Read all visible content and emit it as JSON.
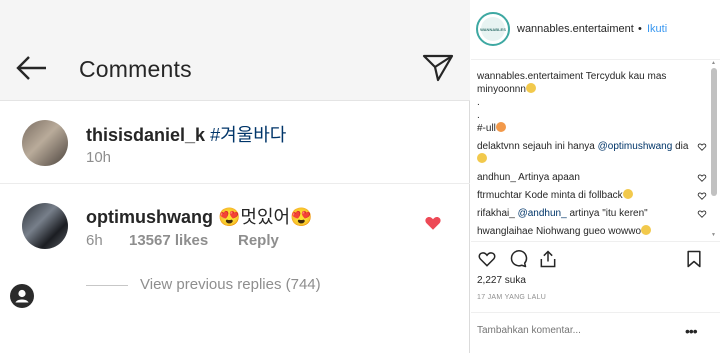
{
  "app": {
    "header_title": "Comments",
    "comments": [
      {
        "username": "thisisdaniel_k",
        "text": "#겨울바다",
        "time": "10h"
      },
      {
        "username": "optimushwang",
        "text": "😍멋있어😍",
        "time": "6h",
        "likes": "13567 likes",
        "reply": "Reply"
      }
    ],
    "view_previous": "View previous replies (744)"
  },
  "post": {
    "avatar_text": "WANNABLES",
    "username": "wannables.entertaiment",
    "separator": "•",
    "follow": "Ikuti",
    "comments": [
      {
        "user": "wannables.entertaiment",
        "text": "Tercyduk kau mas minyoonnn"
      },
      {
        "user": "",
        "text": "."
      },
      {
        "user": "",
        "text": "."
      },
      {
        "user": "",
        "text": "#-ull"
      },
      {
        "user": "delaktvnn",
        "text": "sejauh ini hanya",
        "mention": "@optimushwang",
        "tail": "dia"
      },
      {
        "user": "andhun_",
        "text": "Artinya apaan"
      },
      {
        "user": "ftrmuchtar",
        "text": "Kode minta di follback"
      },
      {
        "user": "rifakhai_",
        "mention": "@andhun_",
        "text": "artinya \"itu keren\""
      },
      {
        "user": "hwanglaihae",
        "text": "Niohwang gueo wowwo"
      }
    ],
    "likes": "2,227 suka",
    "time": "17 JAM YANG LALU",
    "add_comment_placeholder": "Tambahkan komentar...",
    "more": "•••"
  },
  "colors": {
    "accent": "#3897f0",
    "heart": "#ed4956",
    "hashtag": "#003569"
  }
}
